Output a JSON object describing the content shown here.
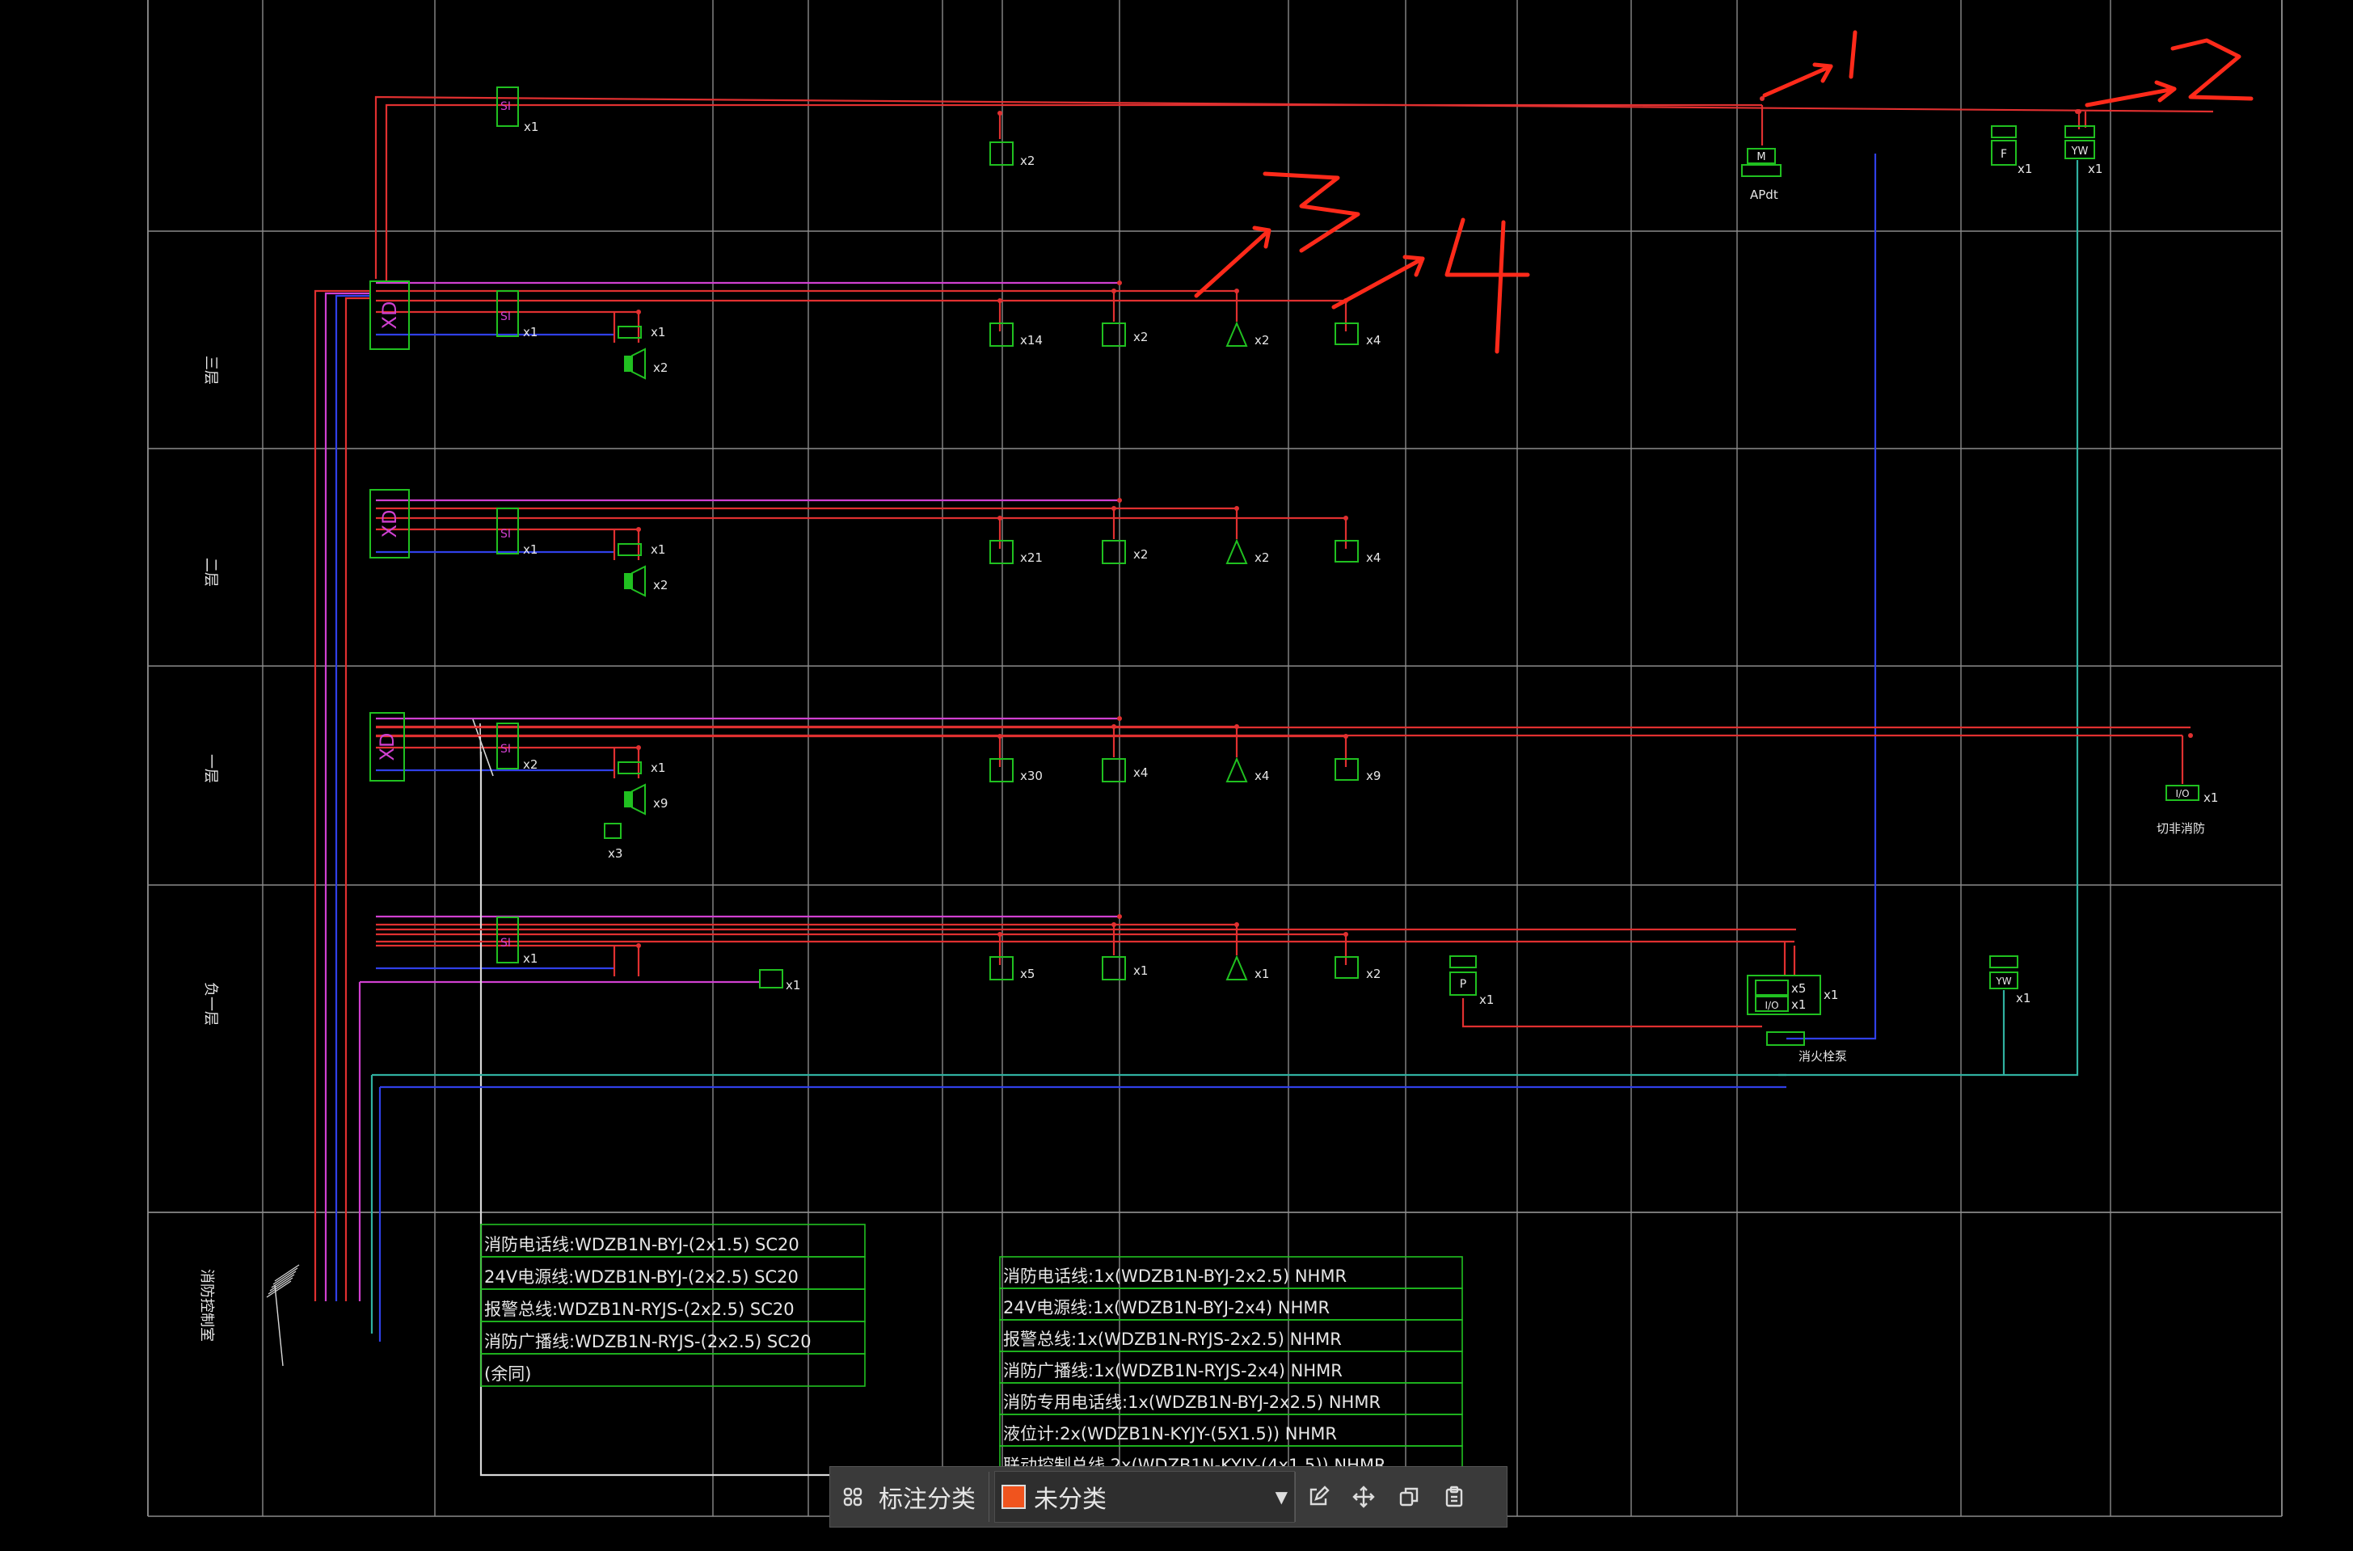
{
  "colors": {
    "grid": "#8a8a8a",
    "red": "#e03030",
    "magenta": "#d040d0",
    "blue": "#3040e8",
    "green": "#20c020",
    "cyan": "#30b0a0",
    "white": "#d8d8d8",
    "annotation": "#ff2a1a",
    "category_swatch": "#f0541e"
  },
  "annotations": [
    "1",
    "2",
    "3",
    "4"
  ],
  "floors": [
    {
      "label": "三层",
      "xd": "XD",
      "si_count": "x1",
      "io_count": "x1",
      "horn_count": "x2",
      "smoke": "x14",
      "heat": "x2",
      "alarm": "x2",
      "hydrant": "x4"
    },
    {
      "label": "二层",
      "xd": "XD",
      "si_count": "x1",
      "io_count": "x1",
      "horn_count": "x2",
      "smoke": "x21",
      "heat": "x2",
      "alarm": "x2",
      "hydrant": "x4"
    },
    {
      "label": "一层",
      "xd": "XD",
      "si_count": "x2",
      "io_count": "x1",
      "speaker_count": "x3",
      "horn_count": "x9",
      "smoke": "x30",
      "heat": "x4",
      "alarm": "x4",
      "hydrant": "x9"
    },
    {
      "label": "负一层",
      "si_count": "x1",
      "phone_count": "x1",
      "smoke": "x5",
      "heat": "x1",
      "alarm": "x1",
      "hydrant": "x2"
    }
  ],
  "roof": {
    "si_count": "x1",
    "smoke": "x2",
    "m_label": "M",
    "m_caption": "APdt",
    "f_label": "F",
    "f_count": "x1",
    "yw_label": "YW",
    "yw_count": "x1"
  },
  "floor1_extra": {
    "io_label": "I/O",
    "io_count": "x1",
    "caption": "切非消防"
  },
  "basement_extra": {
    "p_label": "P",
    "p_count": "x1",
    "pump_counts": [
      "x5",
      "x1",
      "x1"
    ],
    "pump_caption": "消火栓泵",
    "yw_label": "YW",
    "yw_count": "x1"
  },
  "center_label": "消防控制室",
  "legend_left": [
    "消防电话线:WDZB1N-BYJ-(2x1.5) SC20",
    "24V电源线:WDZB1N-BYJ-(2x2.5) SC20",
    "报警总线:WDZB1N-RYJS-(2x2.5) SC20",
    "消防广播线:WDZB1N-RYJS-(2x2.5) SC20",
    "(余同)"
  ],
  "legend_right": [
    "消防电话线:1x(WDZB1N-BYJ-2x2.5) NHMR",
    "24V电源线:1x(WDZB1N-BYJ-2x4) NHMR",
    "报警总线:1x(WDZB1N-RYJS-2x2.5) NHMR",
    "消防广播线:1x(WDZB1N-RYJS-2x4) NHMR",
    "消防专用电话线:1x(WDZB1N-BYJ-2x2.5) NHMR",
    "液位计:2x(WDZB1N-KYJY-(5X1.5)) NHMR",
    "联动控制总线 2x(WDZB1N-KYJY-(4x1.5)) NHMR"
  ],
  "toolbar": {
    "grid_icon": "grid-icon",
    "label": "标注分类",
    "category_value": "未分类",
    "icons": [
      "edit-icon",
      "move-icon",
      "copy-icon",
      "paste-icon"
    ]
  }
}
